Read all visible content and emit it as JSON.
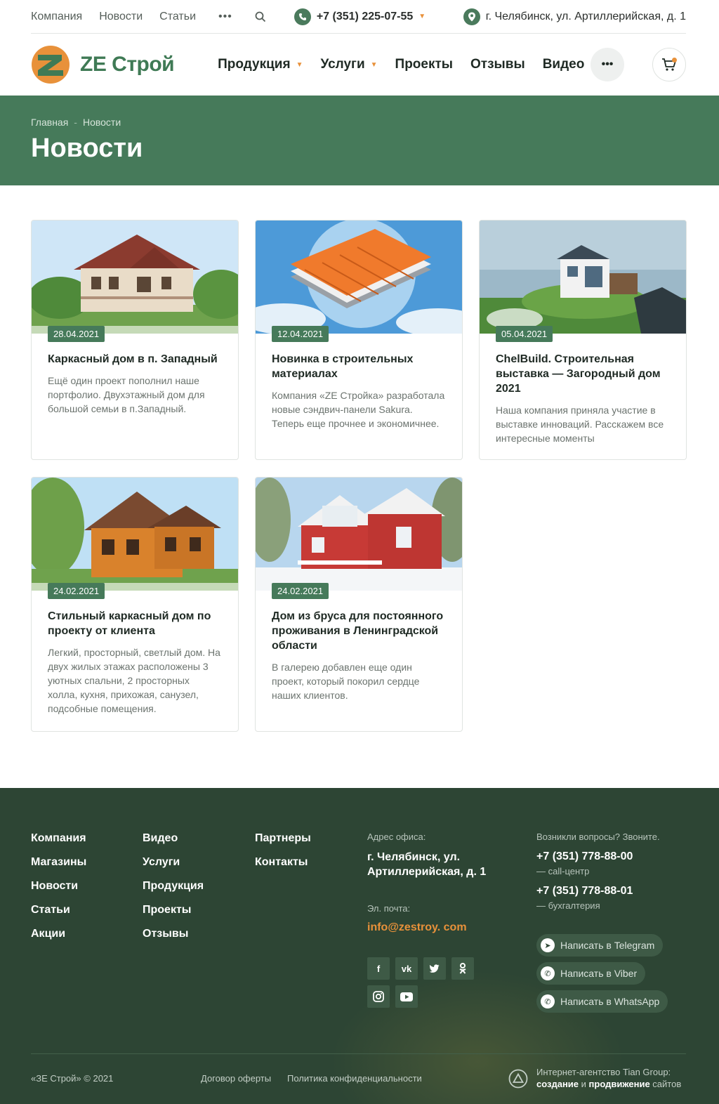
{
  "topbar": {
    "nav": [
      "Компания",
      "Новости",
      "Статьи"
    ],
    "more": "•••",
    "phone": "+7 (351) 225-07-55",
    "address": "г. Челябинск, ул. Артиллерийская, д. 1"
  },
  "header": {
    "logo_text": "ZE Строй",
    "nav": [
      "Продукция",
      "Услуги",
      "Проекты",
      "Отзывы",
      "Видео"
    ],
    "more": "•••"
  },
  "banner": {
    "breadcrumb_home": "Главная",
    "breadcrumb_sep": "-",
    "breadcrumb_current": "Новости",
    "title": "Новости"
  },
  "cards": [
    {
      "date": "28.04.2021",
      "title": "Каркасный дом в п. Западный",
      "text": "Ещё один проект пополнил наше портфолио. Двухэтажный дом для большой семьи в п.Западный."
    },
    {
      "date": "12.04.2021",
      "title": "Новинка в строительных материалах",
      "text": "Компания «ZE Стройка» разработала новые сэндвич-панели Sakura. Теперь еще прочнее и экономичнее."
    },
    {
      "date": "05.04.2021",
      "title": "ChelBuild. Строительная выставка — Загородный дом 2021",
      "text": "Наша компания приняла участие в выставке инноваций. Расскажем все интересные моменты"
    },
    {
      "date": "24.02.2021",
      "title": "Стильный каркасный дом по проекту от клиента",
      "text": "Легкий, просторный, светлый дом. На двух жилых этажах расположены 3 уютных спальни, 2 просторных холла, кухня, прихожая, санузел, подсобные помещения."
    },
    {
      "date": "24.02.2021",
      "title": "Дом из бруса для постоянного проживания в Ленинградской области",
      "text": "В галерею добавлен еще один проект, который покорил сердце наших клиентов."
    }
  ],
  "footer": {
    "col1": [
      "Компания",
      "Магазины",
      "Новости",
      "Статьи",
      "Акции"
    ],
    "col2": [
      "Видео",
      "Услуги",
      "Продукция",
      "Проекты",
      "Отзывы"
    ],
    "col3": [
      "Партнеры",
      "Контакты"
    ],
    "address_label": "Адрес офиса:",
    "address": "г. Челябинск, ул. Артиллерийская, д. 1",
    "email_label": "Эл. почта:",
    "email": "info@zestroy. com",
    "questions_label": "Возникли вопросы? Звоните.",
    "phone1": "+7 (351) 778-88-00",
    "phone1_note": "— call-центр",
    "phone2": "+7 (351) 778-88-01",
    "phone2_note": "— бухгалтерия",
    "telegram": "Написать в Telegram",
    "viber": "Написать в Viber",
    "whatsapp": "Написать в WhatsApp",
    "copyright": "«ЗЕ Строй» © 2021",
    "offer": "Договор оферты",
    "privacy": "Политика конфиденциальности",
    "agency_line1": "Интернет-агентство Tian Group:",
    "agency_create": "создание",
    "agency_and": " и ",
    "agency_promo": "продвижение",
    "agency_sites": " сайтов"
  },
  "colors": {
    "brand_green": "#467a5a",
    "accent_orange": "#e8913a",
    "footer_bg": "#2d4534"
  }
}
